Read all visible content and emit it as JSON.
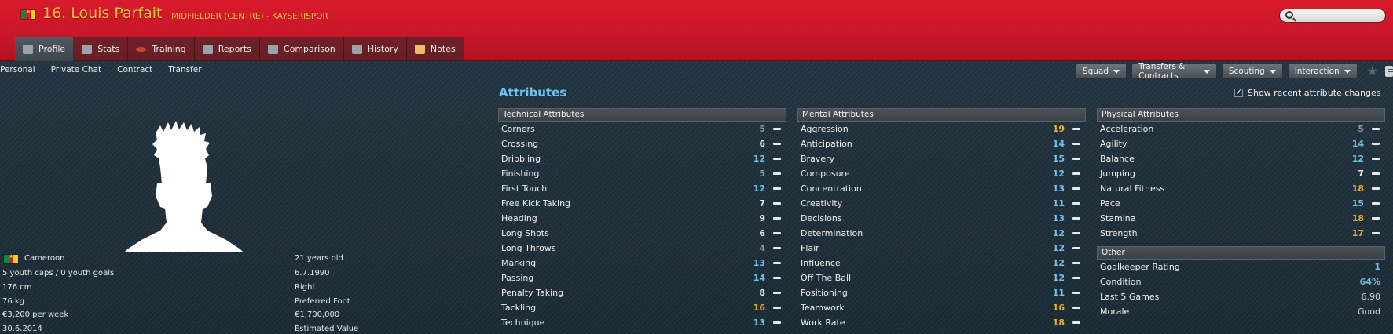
{
  "header": {
    "title": "16. Louis Parfait",
    "subtitle": "MIDFIELDER (CENTRE) - KAYSERISPOR",
    "search_placeholder": ""
  },
  "tabs": [
    {
      "label": "Profile",
      "icon": "profile-icon",
      "active": true
    },
    {
      "label": "Stats",
      "icon": "stats-icon"
    },
    {
      "label": "Training",
      "icon": "training-icon"
    },
    {
      "label": "Reports",
      "icon": "reports-icon"
    },
    {
      "label": "Comparison",
      "icon": "comparison-icon"
    },
    {
      "label": "History",
      "icon": "history-icon"
    },
    {
      "label": "Notes",
      "icon": "notes-icon"
    }
  ],
  "subnav": [
    "Personal",
    "Private Chat",
    "Contract",
    "Transfer"
  ],
  "actions": [
    "Squad",
    "Transfers & Contracts",
    "Scouting",
    "Interaction"
  ],
  "bio": {
    "nation": "Cameroon",
    "youth": "5 youth caps / 0 youth goals",
    "height": "176 cm",
    "weight": "76 kg",
    "wage": "€3,200 per week",
    "contract_end": "30.6.2014",
    "age": "21 years old",
    "dob": "6.7.1990",
    "foot": "Right",
    "foot_label": "Preferred Foot",
    "value": "€1,700,000",
    "value_label": "Estimated Value"
  },
  "attributes_title": "Attributes",
  "show_recent_label": "Show recent attribute changes",
  "technical": {
    "title": "Technical Attributes",
    "rows": [
      {
        "name": "Corners",
        "value": "5"
      },
      {
        "name": "Crossing",
        "value": "6"
      },
      {
        "name": "Dribbling",
        "value": "12"
      },
      {
        "name": "Finishing",
        "value": "5"
      },
      {
        "name": "First Touch",
        "value": "12"
      },
      {
        "name": "Free Kick Taking",
        "value": "7"
      },
      {
        "name": "Heading",
        "value": "9"
      },
      {
        "name": "Long Shots",
        "value": "6"
      },
      {
        "name": "Long Throws",
        "value": "4"
      },
      {
        "name": "Marking",
        "value": "13"
      },
      {
        "name": "Passing",
        "value": "14"
      },
      {
        "name": "Penalty Taking",
        "value": "8"
      },
      {
        "name": "Tackling",
        "value": "16"
      },
      {
        "name": "Technique",
        "value": "13"
      }
    ]
  },
  "mental": {
    "title": "Mental Attributes",
    "rows": [
      {
        "name": "Aggression",
        "value": "19"
      },
      {
        "name": "Anticipation",
        "value": "14"
      },
      {
        "name": "Bravery",
        "value": "15"
      },
      {
        "name": "Composure",
        "value": "12"
      },
      {
        "name": "Concentration",
        "value": "13"
      },
      {
        "name": "Creativity",
        "value": "11"
      },
      {
        "name": "Decisions",
        "value": "13"
      },
      {
        "name": "Determination",
        "value": "12"
      },
      {
        "name": "Flair",
        "value": "12"
      },
      {
        "name": "Influence",
        "value": "12"
      },
      {
        "name": "Off The Ball",
        "value": "12"
      },
      {
        "name": "Positioning",
        "value": "11"
      },
      {
        "name": "Teamwork",
        "value": "16"
      },
      {
        "name": "Work Rate",
        "value": "18"
      }
    ]
  },
  "physical": {
    "title": "Physical Attributes",
    "rows": [
      {
        "name": "Acceleration",
        "value": "5"
      },
      {
        "name": "Agility",
        "value": "14"
      },
      {
        "name": "Balance",
        "value": "12"
      },
      {
        "name": "Jumping",
        "value": "7"
      },
      {
        "name": "Natural Fitness",
        "value": "18"
      },
      {
        "name": "Pace",
        "value": "15"
      },
      {
        "name": "Stamina",
        "value": "18"
      },
      {
        "name": "Strength",
        "value": "17"
      }
    ]
  },
  "other": {
    "title": "Other",
    "rows": [
      {
        "name": "Goalkeeper Rating",
        "value": "1"
      },
      {
        "name": "Condition",
        "value": "64%"
      },
      {
        "name": "Last 5 Games",
        "value": "6.90"
      },
      {
        "name": "Morale",
        "value": "Good"
      }
    ]
  },
  "colors": {
    "header_red": "#c8162a",
    "title_gold": "#f7c23b",
    "attr_blue": "#6fc3ec",
    "attr_gold": "#e7b12a"
  }
}
